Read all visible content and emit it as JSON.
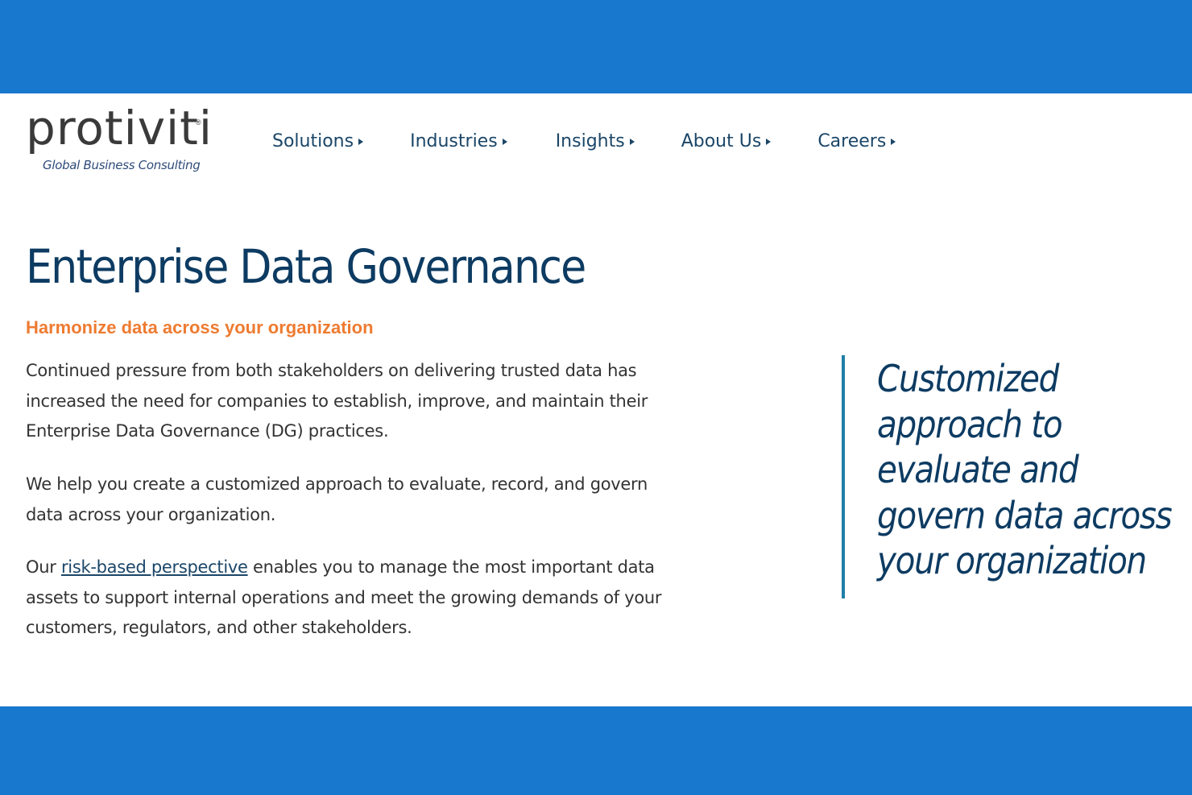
{
  "logo": {
    "wordmark": "protiviti",
    "registered": "®",
    "tagline": "Global Business Consulting"
  },
  "nav": {
    "items": [
      {
        "label": "Solutions"
      },
      {
        "label": "Industries"
      },
      {
        "label": "Insights"
      },
      {
        "label": "About Us"
      },
      {
        "label": "Careers"
      }
    ]
  },
  "main": {
    "title": "Enterprise Data Governance",
    "subtitle": "Harmonize data across your organization",
    "paragraph1": "Continued pressure from both stakeholders on delivering trusted data has increased the need for companies to establish, improve, and maintain their Enterprise Data Governance (DG) practices.",
    "paragraph2": "We help you create a customized approach to evaluate, record, and govern data across your organization.",
    "paragraph3_before": "Our ",
    "paragraph3_link": "risk-based perspective",
    "paragraph3_after": " enables you to manage the most important data assets to support internal operations and meet the growing demands of your customers, regulators, and other stakeholders."
  },
  "quote": {
    "lines": [
      "Customized",
      "approach to",
      "evaluate and",
      "govern data across",
      "your organization"
    ]
  },
  "colors": {
    "band": "#1878cd",
    "heading": "#0d3b62",
    "accent_orange": "#ee7b31",
    "nav_text": "#1b4668",
    "quote_bar": "#1f7fa6"
  }
}
